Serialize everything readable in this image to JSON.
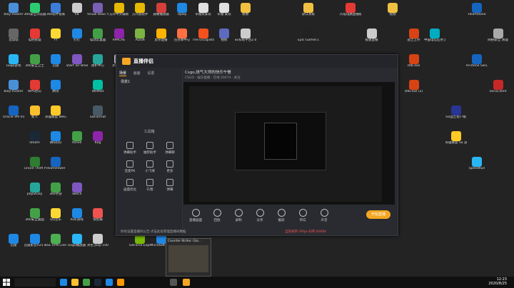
{
  "desktop": {
    "icons": [
      {
        "label": "bloy-master",
        "color": "#4a90d9",
        "col": 0,
        "row": 0
      },
      {
        "label": "360安全浏览器",
        "color": "#2ecc71",
        "col": 1,
        "row": 0
      },
      {
        "label": "360软件管家",
        "color": "#3b7dd8",
        "col": 2,
        "row": 0
      },
      {
        "label": "V8",
        "color": "#cccccc",
        "col": 3,
        "row": 0
      },
      {
        "label": "Visual Basic 6.0编程",
        "color": "#7b5fb3",
        "col": 4,
        "row": 0
      },
      {
        "label": "方外中文辅助",
        "color": "#e6b800",
        "col": 5,
        "row": 0
      },
      {
        "label": "方外此助手",
        "color": "#e6b800",
        "col": 6,
        "row": 0
      },
      {
        "label": "遇曜播放器",
        "color": "#d43f3a",
        "col": 7,
        "row": 0
      },
      {
        "label": "Uplay",
        "color": "#1e88e5",
        "col": 8,
        "row": 0
      },
      {
        "label": "幸福式安装",
        "color": "#e0e0e0",
        "col": 9,
        "row": 0
      },
      {
        "label": "幸福·安装",
        "color": "#e0e0e0",
        "col": 10,
        "row": 0
      },
      {
        "label": "谢谢",
        "color": "#f0c040",
        "col": 11,
        "row": 0
      },
      {
        "label": "默认系统",
        "color": "#f0c040",
        "col": 14,
        "row": 0
      },
      {
        "label": "闪电电路直播插件",
        "color": "#e53935",
        "col": 16,
        "row": 0
      },
      {
        "label": "视频",
        "color": "#f0c040",
        "col": 18,
        "row": 0
      },
      {
        "label": "Heartstone",
        "color": "#1565c0",
        "col": 22,
        "row": 0
      },
      {
        "label": "垃圾站",
        "color": "#666666",
        "col": 0,
        "row": 1
      },
      {
        "label": "电吧管理",
        "color": "#e53935",
        "col": 1,
        "row": 1
      },
      {
        "label": "YY",
        "color": "#fdd835",
        "col": 2,
        "row": 1
      },
      {
        "label": "钉钉",
        "color": "#1e88e5",
        "col": 3,
        "row": 1
      },
      {
        "label": "电动云桌面",
        "color": "#43a047",
        "col": 4,
        "row": 1
      },
      {
        "label": "APACHE",
        "color": "#8e24aa",
        "col": 5,
        "row": 1
      },
      {
        "label": "ALIEN",
        "color": "#7cb342",
        "col": 6,
        "row": 1
      },
      {
        "label": "虎牙直播",
        "color": "#ffb300",
        "col": 7,
        "row": 1
      },
      {
        "label": "百分库中心",
        "color": "#ff7043",
        "col": 8,
        "row": 1
      },
      {
        "label": "The Escapists 2",
        "color": "#f4511e",
        "col": 9,
        "row": 1
      },
      {
        "label": "拍照",
        "color": "#5c6bc0",
        "col": 10,
        "row": 1
      },
      {
        "label": "SE科技平台2.0",
        "color": "#cccccc",
        "col": 11,
        "row": 1
      },
      {
        "label": "Epic Games Launcher",
        "color": "#222222",
        "col": 14,
        "row": 1
      },
      {
        "label": "极速直播",
        "color": "#cccccc",
        "col": 17,
        "row": 1
      },
      {
        "label": "战士上传",
        "color": "#d84315",
        "col": 19,
        "row": 1
      },
      {
        "label": "中国电信应用 虚拟机NOC",
        "color": "#00acc1",
        "col": 20,
        "row": 1
      },
      {
        "label": "网络安全 清理",
        "color": "#aaaaaa",
        "col": 23,
        "row": 1
      },
      {
        "label": "Gogo游戏",
        "color": "#29b6f6",
        "col": 0,
        "row": 2
      },
      {
        "label": "360安全卫士",
        "color": "#43a047",
        "col": 1,
        "row": 2
      },
      {
        "label": "迅雷",
        "color": "#1e88e5",
        "col": 2,
        "row": 2
      },
      {
        "label": "Start Tor Browser",
        "color": "#7e57c2",
        "col": 3,
        "row": 2
      },
      {
        "label": "防护中心",
        "color": "#26a69a",
        "col": 4,
        "row": 2
      },
      {
        "label": "新建文本",
        "color": "#eeeeee",
        "col": 5,
        "row": 2
      },
      {
        "label": "stlb.exe",
        "color": "#d84315",
        "col": 19,
        "row": 2
      },
      {
        "label": "HFstone Secure",
        "color": "#1565c0",
        "col": 22,
        "row": 2
      },
      {
        "label": "bloy-master",
        "color": "#4a90d9",
        "col": 0,
        "row": 3
      },
      {
        "label": "WPS办公",
        "color": "#e53935",
        "col": 1,
        "row": 3
      },
      {
        "label": "腾讯",
        "color": "#1e88e5",
        "col": 2,
        "row": 3
      },
      {
        "label": "WeMod",
        "color": "#00bfa5",
        "col": 4,
        "row": 3
      },
      {
        "label": "stlb.exe (2)",
        "color": "#d84315",
        "col": 19,
        "row": 3
      },
      {
        "label": "SecuClient",
        "color": "#c62828",
        "col": 23,
        "row": 3
      },
      {
        "label": "Oracle VM VirtualBox",
        "color": "#1565c0",
        "col": 0,
        "row": 4
      },
      {
        "label": "新人",
        "color": "#fbc02d",
        "col": 1,
        "row": 4
      },
      {
        "label": "英雄联盟 WeGame",
        "color": "#ffca28",
        "col": 2,
        "row": 4
      },
      {
        "label": "SDFormat",
        "color": "#455a64",
        "col": 4,
        "row": 4
      },
      {
        "label": "邮箱",
        "color": "#eeeeee",
        "col": 18,
        "row": 4
      },
      {
        "label": "SV国土客户端",
        "color": "#283593",
        "col": 21,
        "row": 4
      },
      {
        "label": "Steam",
        "color": "#1b2838",
        "col": 1,
        "row": 5
      },
      {
        "label": "腾讯QQ",
        "color": "#1e88e5",
        "col": 2,
        "row": 5
      },
      {
        "label": "Xshell",
        "color": "#43a047",
        "col": 3,
        "row": 5
      },
      {
        "label": "Kkg",
        "color": "#8e24aa",
        "col": 4,
        "row": 5
      },
      {
        "label": "英雄联盟 Sa 游戏",
        "color": "#ffca28",
        "col": 21,
        "row": 5
      },
      {
        "label": "Grand Theft Auto V",
        "color": "#2e7d32",
        "col": 1,
        "row": 6
      },
      {
        "label": "TeamViewer",
        "color": "#1565c0",
        "col": 2,
        "row": 6
      },
      {
        "label": "SpeedRun",
        "color": "#29b6f6",
        "col": 22,
        "row": 6
      },
      {
        "label": "phpStudy",
        "color": "#26a69a",
        "col": 1,
        "row": 7
      },
      {
        "label": "360手游",
        "color": "#43a047",
        "col": 2,
        "row": 7
      },
      {
        "label": "Twitch",
        "color": "#7e57c2",
        "col": 3,
        "row": 7
      },
      {
        "label": "360安全桌面",
        "color": "#43a047",
        "col": 1,
        "row": 8
      },
      {
        "label": "QQ音乐",
        "color": "#fdd835",
        "col": 2,
        "row": 8
      },
      {
        "label": "XDE游戏",
        "color": "#1e88e5",
        "col": 3,
        "row": 8
      },
      {
        "label": "快剪辑",
        "color": "#ef5350",
        "col": 4,
        "row": 8
      },
      {
        "label": "迅雷",
        "color": "#1e88e5",
        "col": 0,
        "row": 9
      },
      {
        "label": "迅雷影音V25.exe",
        "color": "#1e88e5",
        "col": 1,
        "row": 9
      },
      {
        "label": "SSL VPN Client",
        "color": "#4caf50",
        "col": 2,
        "row": 9
      },
      {
        "label": "Gogo播放器",
        "color": "#29b6f6",
        "col": 3,
        "row": 9
      },
      {
        "label": "英伦 Jusp 100%",
        "color": "#cccccc",
        "col": 4,
        "row": 9
      },
      {
        "label": "GeForce Experience",
        "color": "#76b900",
        "col": 6,
        "row": 9
      },
      {
        "label": "Microsoft Edge",
        "color": "#1e88e5",
        "col": 7,
        "row": 9
      }
    ]
  },
  "window": {
    "app_title": "直播伴侣",
    "side_tabs": [
      "场景",
      "画面",
      "设置"
    ],
    "scene_label": "场景1",
    "tools_title": "工具箱",
    "tools": [
      "弹幕助手",
      "抽奖助手",
      "弹幕聊",
      "连麦PK",
      "小飞球",
      "更多",
      "画面优化",
      "礼物",
      "弹幕"
    ],
    "stream_title": "Csgo,烧气大师的快乐午餐",
    "stream_meta": "CSGO · 娱乐直播 · 在线 20474 · 关注",
    "controls": [
      "直播画面",
      "回放",
      "录制",
      "分享",
      "截屏",
      "单向",
      "声音"
    ],
    "start_label": "开始直播",
    "footer_text": "你有设置直播间公告·点击此处管理直播间数据",
    "footer_status": "当前帧率:30fps 码率:4000k"
  },
  "popup": {
    "title": "Counter-Strike: Glo..."
  },
  "taskbar": {
    "search_placeholder": "",
    "time": "12:23",
    "date": "2020/8/25"
  }
}
